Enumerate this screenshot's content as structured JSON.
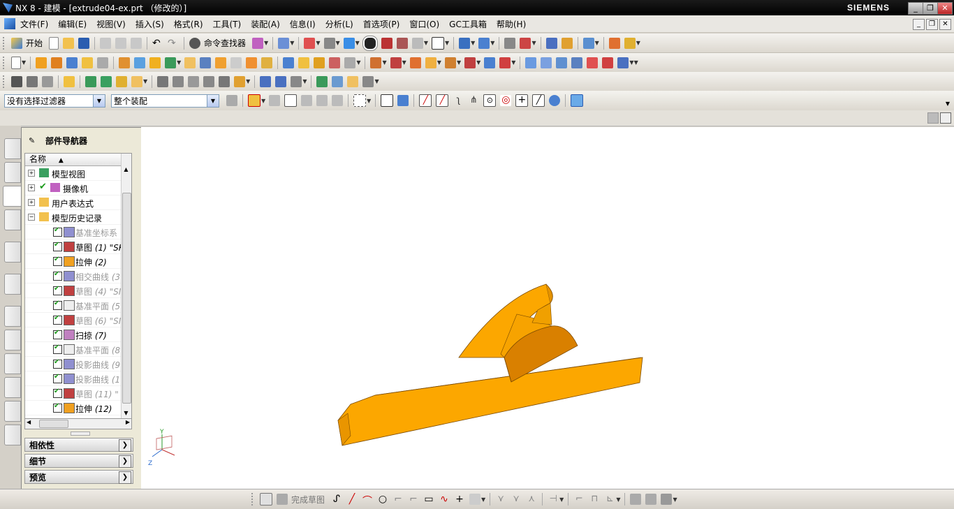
{
  "window": {
    "title": "NX 8 - 建模 - [extrude04-ex.prt （修改的）]",
    "brand": "SIEMENS"
  },
  "menubar": {
    "items": [
      "文件(F)",
      "编辑(E)",
      "视图(V)",
      "插入(S)",
      "格式(R)",
      "工具(T)",
      "装配(A)",
      "信息(I)",
      "分析(L)",
      "首选项(P)",
      "窗口(O)",
      "GC工具箱",
      "帮助(H)"
    ]
  },
  "toolbar1": {
    "start_label": "开始",
    "command_finder_label": "命令查找器"
  },
  "selection_bar": {
    "filter_value": "没有选择过滤器",
    "scope_value": "整个装配"
  },
  "part_navigator": {
    "title": "部件导航器",
    "column_name": "名称",
    "items": [
      {
        "label": "模型视图",
        "level": 0,
        "dim": false
      },
      {
        "label": "摄像机",
        "level": 0,
        "dim": false
      },
      {
        "label": "用户表达式",
        "level": 0,
        "dim": false
      },
      {
        "label": "模型历史记录",
        "level": 0,
        "dim": false
      },
      {
        "label": "基准坐标系",
        "suffix": "",
        "level": 1,
        "dim": true
      },
      {
        "label": "草图",
        "suffix": "(1) \"SK",
        "level": 1,
        "dim": false
      },
      {
        "label": "拉伸",
        "suffix": "(2)",
        "level": 1,
        "dim": false
      },
      {
        "label": "相交曲线",
        "suffix": "(3",
        "level": 1,
        "dim": true
      },
      {
        "label": "草图",
        "suffix": "(4) \"SI",
        "level": 1,
        "dim": true
      },
      {
        "label": "基准平面",
        "suffix": "(5",
        "level": 1,
        "dim": true
      },
      {
        "label": "草图",
        "suffix": "(6) \"SI",
        "level": 1,
        "dim": true
      },
      {
        "label": "扫掠",
        "suffix": "(7)",
        "level": 1,
        "dim": false
      },
      {
        "label": "基准平面",
        "suffix": "(8",
        "level": 1,
        "dim": true
      },
      {
        "label": "投影曲线",
        "suffix": "(9",
        "level": 1,
        "dim": true
      },
      {
        "label": "投影曲线",
        "suffix": "(1",
        "level": 1,
        "dim": true
      },
      {
        "label": "草图",
        "suffix": "(11) \"",
        "level": 1,
        "dim": true
      },
      {
        "label": "拉伸",
        "suffix": "(12)",
        "level": 1,
        "dim": false
      }
    ],
    "panels": [
      "相依性",
      "细节",
      "预览"
    ]
  },
  "triad": {
    "y": "Y",
    "z": "Z"
  },
  "bottom_toolbar": {
    "finish_sketch_label": "完成草图"
  },
  "colors": {
    "part_light": "#fca700",
    "part_dark": "#d98000"
  }
}
